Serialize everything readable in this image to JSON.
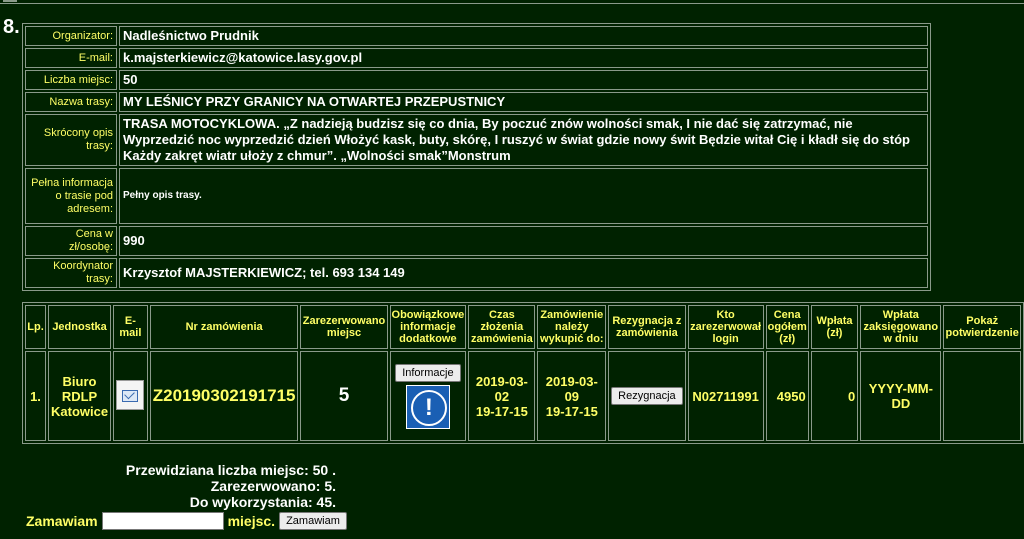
{
  "section_number": "8.",
  "info": {
    "organizer_label": "Organizator:",
    "organizer": "Nadleśnictwo Prudnik",
    "email_label": "E-mail:",
    "email": "k.majsterkiewicz@katowice.lasy.gov.pl",
    "seats_label": "Liczba miejsc:",
    "seats": "50",
    "route_name_label": "Nazwa trasy:",
    "route_name": "MY LEŚNICY PRZY GRANICY NA OTWARTEJ PRZEPUSTNICY",
    "short_desc_label": "Skrócony opis trasy:",
    "short_desc": "TRASA MOTOCYKLOWA. „Z nadzieją budzisz się co dnia, By poczuć znów wolności smak, I nie dać się zatrzymać, nie Wyprzedzić noc wyprzedzić dzień Włożyć kask, buty, skórę, I ruszyć w świat gdzie nowy świt Będzie witał Cię i kładł się do stóp Każdy zakręt wiatr ułoży z chmur”. „Wolności smak”Monstrum",
    "full_info_label": "Pełna informacja o trasie pod adresem:",
    "full_info": "Pełny opis trasy.",
    "price_label": "Cena w zł/osobę:",
    "price": "990",
    "coordinator_label": "Koordynator trasy:",
    "coordinator": "Krzysztof MAJSTERKIEWICZ; tel. 693 134 149"
  },
  "orders": {
    "headers": [
      "Lp.",
      "Jednostka",
      "E-mail",
      "Nr zamówienia",
      "Zarezerwowano miejsc",
      "Obowiązkowe informacje dodatkowe",
      "Czas złożenia zamówienia",
      "Zamówienie należy wykupić do:",
      "Rezygnacja z zamówienia",
      "Kto zarezerwował login",
      "Cena ogółem (zł)",
      "Wpłata (zł)",
      "Wpłata zaksięgowano w dniu",
      "Pokaż potwierdzenie"
    ],
    "rows": [
      {
        "lp": "1.",
        "unit": "Biuro RDLP Katowice",
        "order_no": "Z20190302191715",
        "reserved": "5",
        "info_button": "Informacje",
        "created_date": "2019-03-02",
        "created_time": "19-17-15",
        "due_date": "2019-03-09",
        "due_time": "19-17-15",
        "cancel_button": "Rezygnacja",
        "login": "N02711991",
        "total": "4950",
        "paid": "0",
        "booked_on": "YYYY-MM-DD",
        "confirmation": ""
      }
    ]
  },
  "summary": {
    "expected": "Przewidziana liczba miejsc: 50 .",
    "reserved": "Zarezerwowano: 5.",
    "available": "Do wykorzystania: 45."
  },
  "order_form": {
    "prefix": "Zamawiam",
    "input_value": "",
    "suffix": "miejsc.",
    "button": "Zamawiam"
  }
}
